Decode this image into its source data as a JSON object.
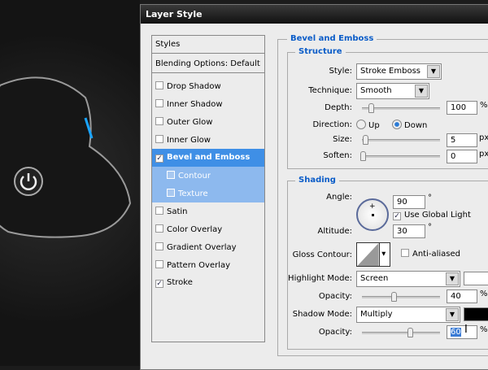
{
  "dialog": {
    "title": "Layer Style"
  },
  "styles_list": {
    "header": "Styles",
    "blending": "Blending Options: Default",
    "items": [
      {
        "label": "Drop Shadow",
        "checked": false
      },
      {
        "label": "Inner Shadow",
        "checked": false
      },
      {
        "label": "Outer Glow",
        "checked": false
      },
      {
        "label": "Inner Glow",
        "checked": false
      },
      {
        "label": "Bevel and Emboss",
        "checked": true
      },
      {
        "label": "Contour",
        "checked": false
      },
      {
        "label": "Texture",
        "checked": false
      },
      {
        "label": "Satin",
        "checked": false
      },
      {
        "label": "Color Overlay",
        "checked": false
      },
      {
        "label": "Gradient Overlay",
        "checked": false
      },
      {
        "label": "Pattern Overlay",
        "checked": false
      },
      {
        "label": "Stroke",
        "checked": true
      }
    ]
  },
  "bevel": {
    "title": "Bevel and Emboss",
    "structure": {
      "title": "Structure",
      "style_label": "Style:",
      "style": "Stroke Emboss",
      "technique_label": "Technique:",
      "technique": "Smooth",
      "depth_label": "Depth:",
      "depth": "100",
      "depth_unit": "%",
      "direction_label": "Direction:",
      "up": "Up",
      "down": "Down",
      "size_label": "Size:",
      "size": "5",
      "size_unit": "px",
      "soften_label": "Soften:",
      "soften": "0",
      "soften_unit": "px"
    },
    "shading": {
      "title": "Shading",
      "angle_label": "Angle:",
      "angle": "90",
      "deg": "°",
      "global_light": "Use Global Light",
      "altitude_label": "Altitude:",
      "altitude": "30",
      "gloss_label": "Gloss Contour:",
      "anti_aliased": "Anti-aliased",
      "highlight_label": "Highlight Mode:",
      "highlight_mode": "Screen",
      "highlight_color": "#ffffff",
      "opacity_label": "Opacity:",
      "highlight_opacity": "40",
      "shadow_label": "Shadow Mode:",
      "shadow_mode": "Multiply",
      "shadow_color": "#000000",
      "shadow_opacity": "60",
      "pct": "%"
    }
  }
}
